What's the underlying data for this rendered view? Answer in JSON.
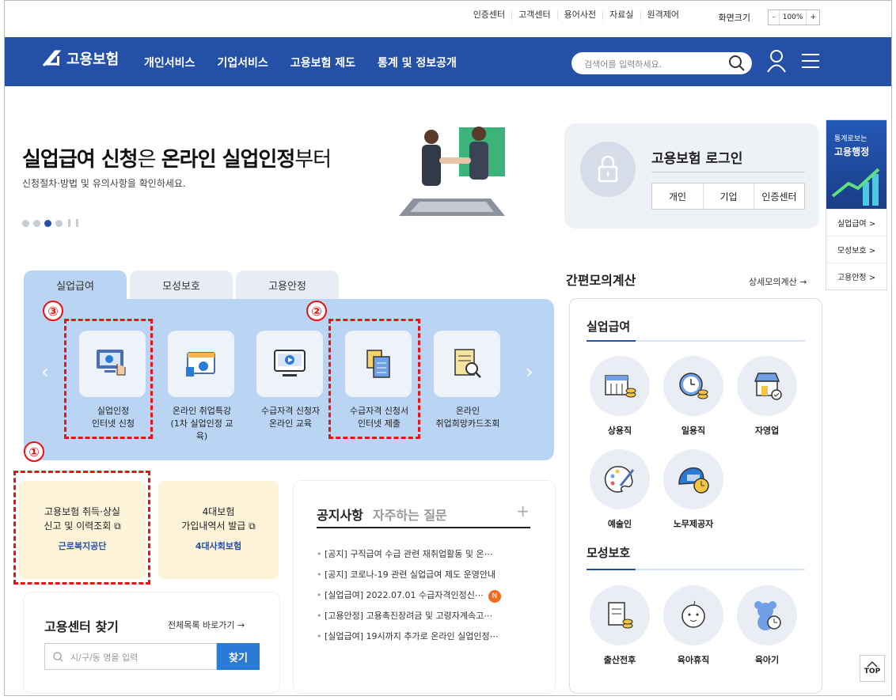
{
  "util": {
    "links": [
      "인증센터",
      "고객센터",
      "용어사전",
      "자료실",
      "원격제어"
    ],
    "zoom_label": "화면크기",
    "zoom_minus": "–",
    "zoom_value": "100%",
    "zoom_plus": "+"
  },
  "header": {
    "logo_text": "고용보험",
    "nav": [
      "개인서비스",
      "기업서비스",
      "고용보험 제도",
      "통계 및 정보공개"
    ],
    "search_placeholder": "검색어를 입력하세요."
  },
  "hero": {
    "title_a": "실업급여 신청",
    "title_b": "은 ",
    "title_c": "온라인 실업인정",
    "title_d": "부터",
    "subtitle": "신청절차·방법 및 유의사항을 확인하세요."
  },
  "login": {
    "title": "고용보험 로그인",
    "buttons": [
      "개인",
      "기업",
      "인증센터"
    ]
  },
  "quick": {
    "small": "통계로보는",
    "big": "고용행정",
    "items": [
      "실업급여 >",
      "모성보호 >",
      "고용안정 >"
    ]
  },
  "tabs": [
    "실업급여",
    "모성보호",
    "고용안정"
  ],
  "services": [
    {
      "line1": "실업인정",
      "line2": "인터넷 신청"
    },
    {
      "line1": "온라인 취업특강",
      "line2": "(1차 실업인정 교육)"
    },
    {
      "line1": "수급자격 신청자",
      "line2": "온라인 교육"
    },
    {
      "line1": "수급자격 신청서",
      "line2": "인터넷 제출"
    },
    {
      "line1": "온라인",
      "line2": "취업희망카드조회"
    }
  ],
  "markers": [
    "①",
    "②",
    "③"
  ],
  "cards": [
    {
      "line1": "고용보험 취득·상실",
      "line2": "신고 및 이력조회",
      "org": "근로복지공단"
    },
    {
      "line1": "4대보험",
      "line2": "가입내역서 발급",
      "org": "4대사회보험"
    }
  ],
  "notice": {
    "tab_on": "공지사항",
    "tab_off": "자주하는 질문",
    "plus": "+",
    "items": [
      "[공지] 구직급여 수급 관련 재취업활동 및 온⋯",
      "[공지] 코로나-19 관련 실업급여 제도 운영안내",
      "[실업급여] 2022.07.01 수급자격인정신⋯",
      "[고용안정] 고용촉진장려금 및 고령자계속고⋯",
      "[실업급여] 19시까지 추가로 온라인 실업인정⋯"
    ],
    "new_badge": "N"
  },
  "center": {
    "title": "고용센터 찾기",
    "link": "전체목록 바로가기 →",
    "placeholder": "시/구/동 명을 입력",
    "button": "찾기"
  },
  "calc": {
    "title": "간편모의계산",
    "link": "상세모의계산 →",
    "section1": "실업급여",
    "items1": [
      "상용직",
      "일용직",
      "자영업",
      "예술인",
      "노무제공자"
    ],
    "section2": "모성보호",
    "items2": [
      "출산전후",
      "육아휴직",
      "육아기"
    ]
  },
  "top_button": "TOP",
  "colors": {
    "brand": "#2450a8",
    "panel": "#bad4f4",
    "highlight": "#e11111"
  }
}
